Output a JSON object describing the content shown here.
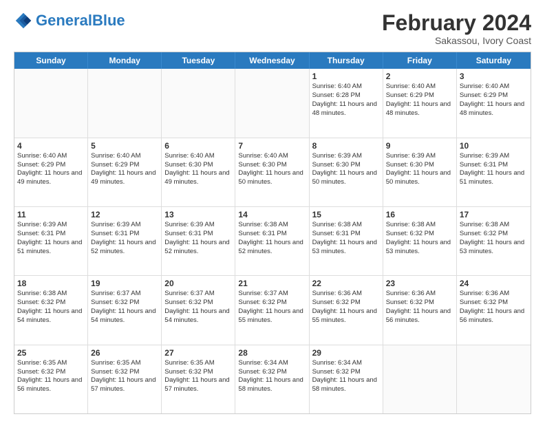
{
  "logo": {
    "text_general": "General",
    "text_blue": "Blue"
  },
  "title": {
    "main": "February 2024",
    "sub": "Sakassou, Ivory Coast"
  },
  "header_days": [
    "Sunday",
    "Monday",
    "Tuesday",
    "Wednesday",
    "Thursday",
    "Friday",
    "Saturday"
  ],
  "weeks": [
    [
      {
        "day": "",
        "sunrise": "",
        "sunset": "",
        "daylight": ""
      },
      {
        "day": "",
        "sunrise": "",
        "sunset": "",
        "daylight": ""
      },
      {
        "day": "",
        "sunrise": "",
        "sunset": "",
        "daylight": ""
      },
      {
        "day": "",
        "sunrise": "",
        "sunset": "",
        "daylight": ""
      },
      {
        "day": "1",
        "sunrise": "Sunrise: 6:40 AM",
        "sunset": "Sunset: 6:28 PM",
        "daylight": "Daylight: 11 hours and 48 minutes."
      },
      {
        "day": "2",
        "sunrise": "Sunrise: 6:40 AM",
        "sunset": "Sunset: 6:29 PM",
        "daylight": "Daylight: 11 hours and 48 minutes."
      },
      {
        "day": "3",
        "sunrise": "Sunrise: 6:40 AM",
        "sunset": "Sunset: 6:29 PM",
        "daylight": "Daylight: 11 hours and 48 minutes."
      }
    ],
    [
      {
        "day": "4",
        "sunrise": "Sunrise: 6:40 AM",
        "sunset": "Sunset: 6:29 PM",
        "daylight": "Daylight: 11 hours and 49 minutes."
      },
      {
        "day": "5",
        "sunrise": "Sunrise: 6:40 AM",
        "sunset": "Sunset: 6:29 PM",
        "daylight": "Daylight: 11 hours and 49 minutes."
      },
      {
        "day": "6",
        "sunrise": "Sunrise: 6:40 AM",
        "sunset": "Sunset: 6:30 PM",
        "daylight": "Daylight: 11 hours and 49 minutes."
      },
      {
        "day": "7",
        "sunrise": "Sunrise: 6:40 AM",
        "sunset": "Sunset: 6:30 PM",
        "daylight": "Daylight: 11 hours and 50 minutes."
      },
      {
        "day": "8",
        "sunrise": "Sunrise: 6:39 AM",
        "sunset": "Sunset: 6:30 PM",
        "daylight": "Daylight: 11 hours and 50 minutes."
      },
      {
        "day": "9",
        "sunrise": "Sunrise: 6:39 AM",
        "sunset": "Sunset: 6:30 PM",
        "daylight": "Daylight: 11 hours and 50 minutes."
      },
      {
        "day": "10",
        "sunrise": "Sunrise: 6:39 AM",
        "sunset": "Sunset: 6:31 PM",
        "daylight": "Daylight: 11 hours and 51 minutes."
      }
    ],
    [
      {
        "day": "11",
        "sunrise": "Sunrise: 6:39 AM",
        "sunset": "Sunset: 6:31 PM",
        "daylight": "Daylight: 11 hours and 51 minutes."
      },
      {
        "day": "12",
        "sunrise": "Sunrise: 6:39 AM",
        "sunset": "Sunset: 6:31 PM",
        "daylight": "Daylight: 11 hours and 52 minutes."
      },
      {
        "day": "13",
        "sunrise": "Sunrise: 6:39 AM",
        "sunset": "Sunset: 6:31 PM",
        "daylight": "Daylight: 11 hours and 52 minutes."
      },
      {
        "day": "14",
        "sunrise": "Sunrise: 6:38 AM",
        "sunset": "Sunset: 6:31 PM",
        "daylight": "Daylight: 11 hours and 52 minutes."
      },
      {
        "day": "15",
        "sunrise": "Sunrise: 6:38 AM",
        "sunset": "Sunset: 6:31 PM",
        "daylight": "Daylight: 11 hours and 53 minutes."
      },
      {
        "day": "16",
        "sunrise": "Sunrise: 6:38 AM",
        "sunset": "Sunset: 6:32 PM",
        "daylight": "Daylight: 11 hours and 53 minutes."
      },
      {
        "day": "17",
        "sunrise": "Sunrise: 6:38 AM",
        "sunset": "Sunset: 6:32 PM",
        "daylight": "Daylight: 11 hours and 53 minutes."
      }
    ],
    [
      {
        "day": "18",
        "sunrise": "Sunrise: 6:38 AM",
        "sunset": "Sunset: 6:32 PM",
        "daylight": "Daylight: 11 hours and 54 minutes."
      },
      {
        "day": "19",
        "sunrise": "Sunrise: 6:37 AM",
        "sunset": "Sunset: 6:32 PM",
        "daylight": "Daylight: 11 hours and 54 minutes."
      },
      {
        "day": "20",
        "sunrise": "Sunrise: 6:37 AM",
        "sunset": "Sunset: 6:32 PM",
        "daylight": "Daylight: 11 hours and 54 minutes."
      },
      {
        "day": "21",
        "sunrise": "Sunrise: 6:37 AM",
        "sunset": "Sunset: 6:32 PM",
        "daylight": "Daylight: 11 hours and 55 minutes."
      },
      {
        "day": "22",
        "sunrise": "Sunrise: 6:36 AM",
        "sunset": "Sunset: 6:32 PM",
        "daylight": "Daylight: 11 hours and 55 minutes."
      },
      {
        "day": "23",
        "sunrise": "Sunrise: 6:36 AM",
        "sunset": "Sunset: 6:32 PM",
        "daylight": "Daylight: 11 hours and 56 minutes."
      },
      {
        "day": "24",
        "sunrise": "Sunrise: 6:36 AM",
        "sunset": "Sunset: 6:32 PM",
        "daylight": "Daylight: 11 hours and 56 minutes."
      }
    ],
    [
      {
        "day": "25",
        "sunrise": "Sunrise: 6:35 AM",
        "sunset": "Sunset: 6:32 PM",
        "daylight": "Daylight: 11 hours and 56 minutes."
      },
      {
        "day": "26",
        "sunrise": "Sunrise: 6:35 AM",
        "sunset": "Sunset: 6:32 PM",
        "daylight": "Daylight: 11 hours and 57 minutes."
      },
      {
        "day": "27",
        "sunrise": "Sunrise: 6:35 AM",
        "sunset": "Sunset: 6:32 PM",
        "daylight": "Daylight: 11 hours and 57 minutes."
      },
      {
        "day": "28",
        "sunrise": "Sunrise: 6:34 AM",
        "sunset": "Sunset: 6:32 PM",
        "daylight": "Daylight: 11 hours and 58 minutes."
      },
      {
        "day": "29",
        "sunrise": "Sunrise: 6:34 AM",
        "sunset": "Sunset: 6:32 PM",
        "daylight": "Daylight: 11 hours and 58 minutes."
      },
      {
        "day": "",
        "sunrise": "",
        "sunset": "",
        "daylight": ""
      },
      {
        "day": "",
        "sunrise": "",
        "sunset": "",
        "daylight": ""
      }
    ]
  ]
}
